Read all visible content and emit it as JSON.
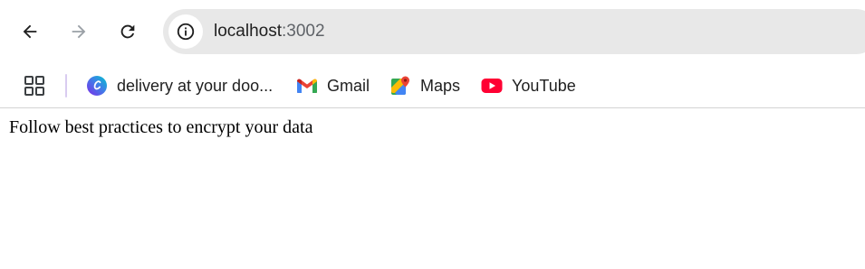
{
  "toolbar": {
    "url_host": "localhost",
    "url_port": ":3002",
    "icons": {
      "back": "arrow-left-icon",
      "forward": "arrow-right-icon",
      "reload": "reload-icon",
      "site_info": "info-icon"
    }
  },
  "bookmarks": {
    "apps_icon": "grid-icon",
    "items": [
      {
        "label": "delivery at your doo...",
        "icon": "canva-icon"
      },
      {
        "label": "Gmail",
        "icon": "gmail-icon"
      },
      {
        "label": "Maps",
        "icon": "maps-icon"
      },
      {
        "label": "YouTube",
        "icon": "youtube-icon"
      }
    ]
  },
  "page": {
    "text": "Follow best practices to encrypt your data"
  },
  "colors": {
    "omnibox_bg": "#e8e8e8",
    "forward_disabled": "#9aa0a6",
    "youtube_red": "#ff0033",
    "gmail_red": "#ea4335"
  }
}
